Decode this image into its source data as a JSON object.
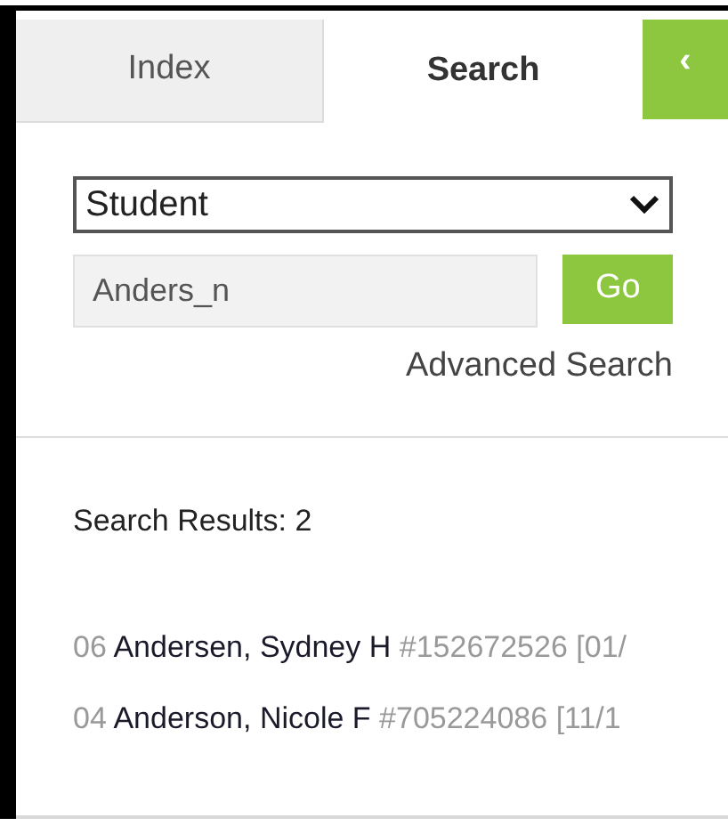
{
  "tabs": [
    {
      "label": "Index",
      "selected": false
    },
    {
      "label": "Search",
      "selected": true
    }
  ],
  "collapse_button": {
    "label": "‹"
  },
  "search_type": {
    "value": "Student"
  },
  "search_field": {
    "value": "Anders_n"
  },
  "go_button": {
    "label": "Go"
  },
  "advanced_search_link": {
    "label": "Advanced Search"
  },
  "results_summary": "Search Results: 2",
  "results": [
    {
      "grade": "06",
      "name": "Andersen, Sydney H",
      "id": "#152672526",
      "date": "[01/"
    },
    {
      "grade": "04",
      "name": "Anderson, Nicole F",
      "id": "#705224086",
      "date": "[11/1"
    }
  ]
}
